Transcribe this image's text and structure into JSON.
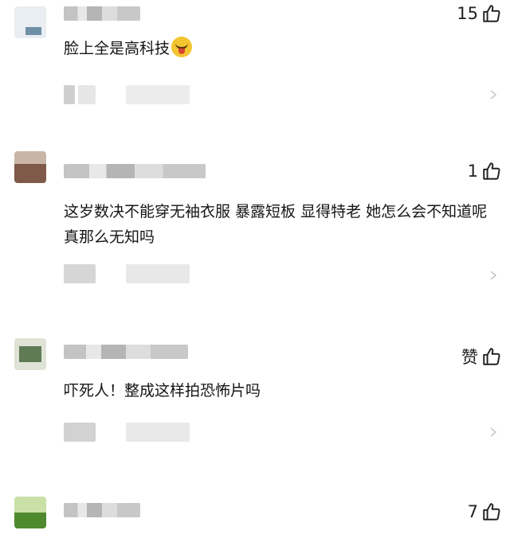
{
  "colors": {
    "background": "#ffffff",
    "text": "#151515",
    "icon": "#222222",
    "placeholder_gray": "#d9d9d9"
  },
  "comments": [
    {
      "text": "脸上全是高科技",
      "has_emoji": true,
      "emoji_icon": "laughing-crying-emoji-icon",
      "likes": "15"
    },
    {
      "text": "这岁数决不能穿无袖衣服 暴露短板 显得特老 她怎么会不知道呢 真那么无知吗",
      "likes": "1"
    },
    {
      "text": "吓死人！整成这样拍恐怖片吗",
      "likes": "赞"
    },
    {
      "text": "",
      "likes": "7"
    }
  ],
  "icons": {
    "like": "thumbs-up-icon",
    "more": "chevron-right-icon"
  }
}
